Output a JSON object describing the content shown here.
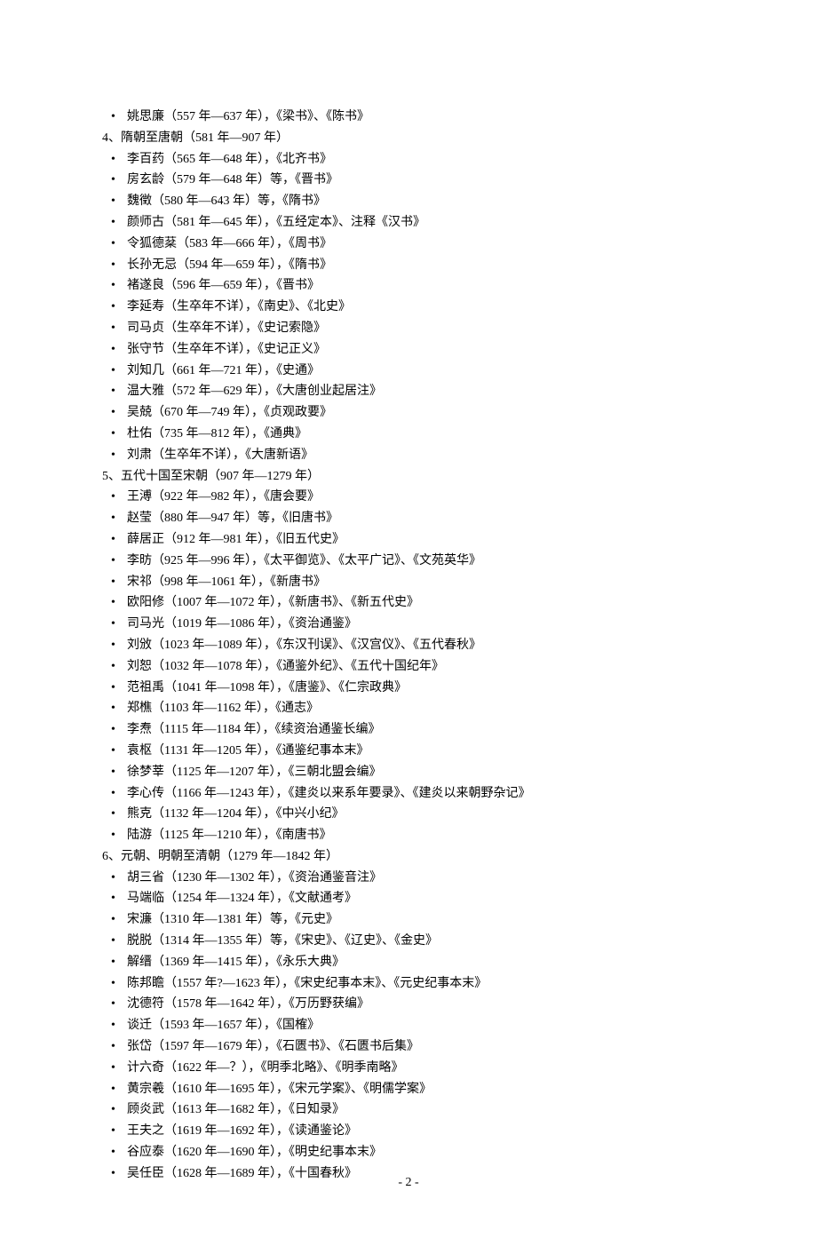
{
  "blocks": [
    {
      "type": "bullet",
      "text": "姚思廉（557 年—637 年），《梁书》、《陈书》"
    },
    {
      "type": "heading",
      "text": "4、隋朝至唐朝（581 年—907 年）"
    },
    {
      "type": "bullet",
      "text": "李百药（565 年—648 年），《北齐书》"
    },
    {
      "type": "bullet",
      "text": "房玄龄（579 年—648 年）等，《晋书》"
    },
    {
      "type": "bullet",
      "text": "魏徵（580 年—643 年）等，《隋书》"
    },
    {
      "type": "bullet",
      "text": "颜师古（581 年—645 年），《五经定本》、注释《汉书》"
    },
    {
      "type": "bullet",
      "text": "令狐德棻（583 年—666 年），《周书》"
    },
    {
      "type": "bullet",
      "text": "长孙无忌（594 年—659 年），《隋书》"
    },
    {
      "type": "bullet",
      "text": "褚遂良（596 年—659 年），《晋书》"
    },
    {
      "type": "bullet",
      "text": "李延寿（生卒年不详），《南史》、《北史》"
    },
    {
      "type": "bullet",
      "text": "司马贞（生卒年不详），《史记索隐》"
    },
    {
      "type": "bullet",
      "text": "张守节（生卒年不详），《史记正义》"
    },
    {
      "type": "bullet",
      "text": "刘知几（661 年—721 年），《史通》"
    },
    {
      "type": "bullet",
      "text": "温大雅（572 年—629 年），《大唐创业起居注》"
    },
    {
      "type": "bullet",
      "text": "吴兢（670 年—749 年），《贞观政要》"
    },
    {
      "type": "bullet",
      "text": "杜佑（735 年—812 年），《通典》"
    },
    {
      "type": "bullet",
      "text": "刘肃（生卒年不详），《大唐新语》"
    },
    {
      "type": "heading",
      "text": "5、五代十国至宋朝（907 年—1279 年）"
    },
    {
      "type": "bullet",
      "text": "王溥（922 年—982 年），《唐会要》"
    },
    {
      "type": "bullet",
      "text": "赵莹（880 年—947 年）等，《旧唐书》"
    },
    {
      "type": "bullet",
      "text": "薛居正（912 年—981 年），《旧五代史》"
    },
    {
      "type": "bullet",
      "text": "李昉（925 年—996 年），《太平御览》、《太平广记》、《文苑英华》"
    },
    {
      "type": "bullet",
      "text": "宋祁（998 年—1061 年），《新唐书》"
    },
    {
      "type": "bullet",
      "text": "欧阳修（1007 年—1072 年），《新唐书》、《新五代史》"
    },
    {
      "type": "bullet",
      "text": "司马光（1019 年—1086 年），《资治通鉴》"
    },
    {
      "type": "bullet",
      "text": "刘攽（1023 年—1089 年），《东汉刊误》、《汉宫仪》、《五代春秋》"
    },
    {
      "type": "bullet",
      "text": "刘恕（1032 年—1078 年），《通鉴外纪》、《五代十国纪年》"
    },
    {
      "type": "bullet",
      "text": "范祖禹（1041 年—1098 年），《唐鉴》、《仁宗政典》"
    },
    {
      "type": "bullet",
      "text": "郑樵（1103 年—1162 年），《通志》"
    },
    {
      "type": "bullet",
      "text": "李焘（1115 年—1184 年），《续资治通鉴长编》"
    },
    {
      "type": "bullet",
      "text": "袁枢（1131 年—1205 年），《通鉴纪事本末》"
    },
    {
      "type": "bullet",
      "text": "徐梦莘（1125 年—1207 年），《三朝北盟会编》"
    },
    {
      "type": "bullet",
      "text": "李心传（1166 年—1243 年），《建炎以来系年要录》、《建炎以来朝野杂记》"
    },
    {
      "type": "bullet",
      "text": "熊克（1132 年—1204 年），《中兴小纪》"
    },
    {
      "type": "bullet",
      "text": "陆游（1125 年—1210 年），《南唐书》"
    },
    {
      "type": "heading",
      "text": "6、元朝、明朝至清朝（1279 年—1842 年）"
    },
    {
      "type": "bullet",
      "text": "胡三省（1230 年—1302 年），《资治通鉴音注》"
    },
    {
      "type": "bullet",
      "text": "马端临（1254 年—1324 年），《文献通考》"
    },
    {
      "type": "bullet",
      "text": "宋濂（1310 年—1381 年）等，《元史》"
    },
    {
      "type": "bullet",
      "text": "脱脱（1314 年—1355 年）等，《宋史》、《辽史》、《金史》"
    },
    {
      "type": "bullet",
      "text": "解缙（1369 年—1415 年），《永乐大典》"
    },
    {
      "type": "bullet",
      "text": "陈邦瞻（1557 年?—1623 年），《宋史纪事本末》、《元史纪事本末》"
    },
    {
      "type": "bullet",
      "text": "沈德符（1578 年—1642 年），《万历野获编》"
    },
    {
      "type": "bullet",
      "text": "谈迁（1593 年—1657 年），《国榷》"
    },
    {
      "type": "bullet",
      "text": "张岱（1597 年—1679 年），《石匮书》、《石匮书后集》"
    },
    {
      "type": "bullet",
      "text": "计六奇（1622 年—？），《明季北略》、《明季南略》"
    },
    {
      "type": "bullet",
      "text": "黄宗羲（1610 年—1695 年），《宋元学案》、《明儒学案》"
    },
    {
      "type": "bullet",
      "text": "顾炎武（1613 年—1682 年），《日知录》"
    },
    {
      "type": "bullet",
      "text": "王夫之（1619 年—1692 年），《读通鉴论》"
    },
    {
      "type": "bullet",
      "text": "谷应泰（1620 年—1690 年），《明史纪事本末》"
    },
    {
      "type": "bullet",
      "text": "吴任臣（1628 年—1689 年），《十国春秋》"
    }
  ],
  "page_number": "- 2 -"
}
